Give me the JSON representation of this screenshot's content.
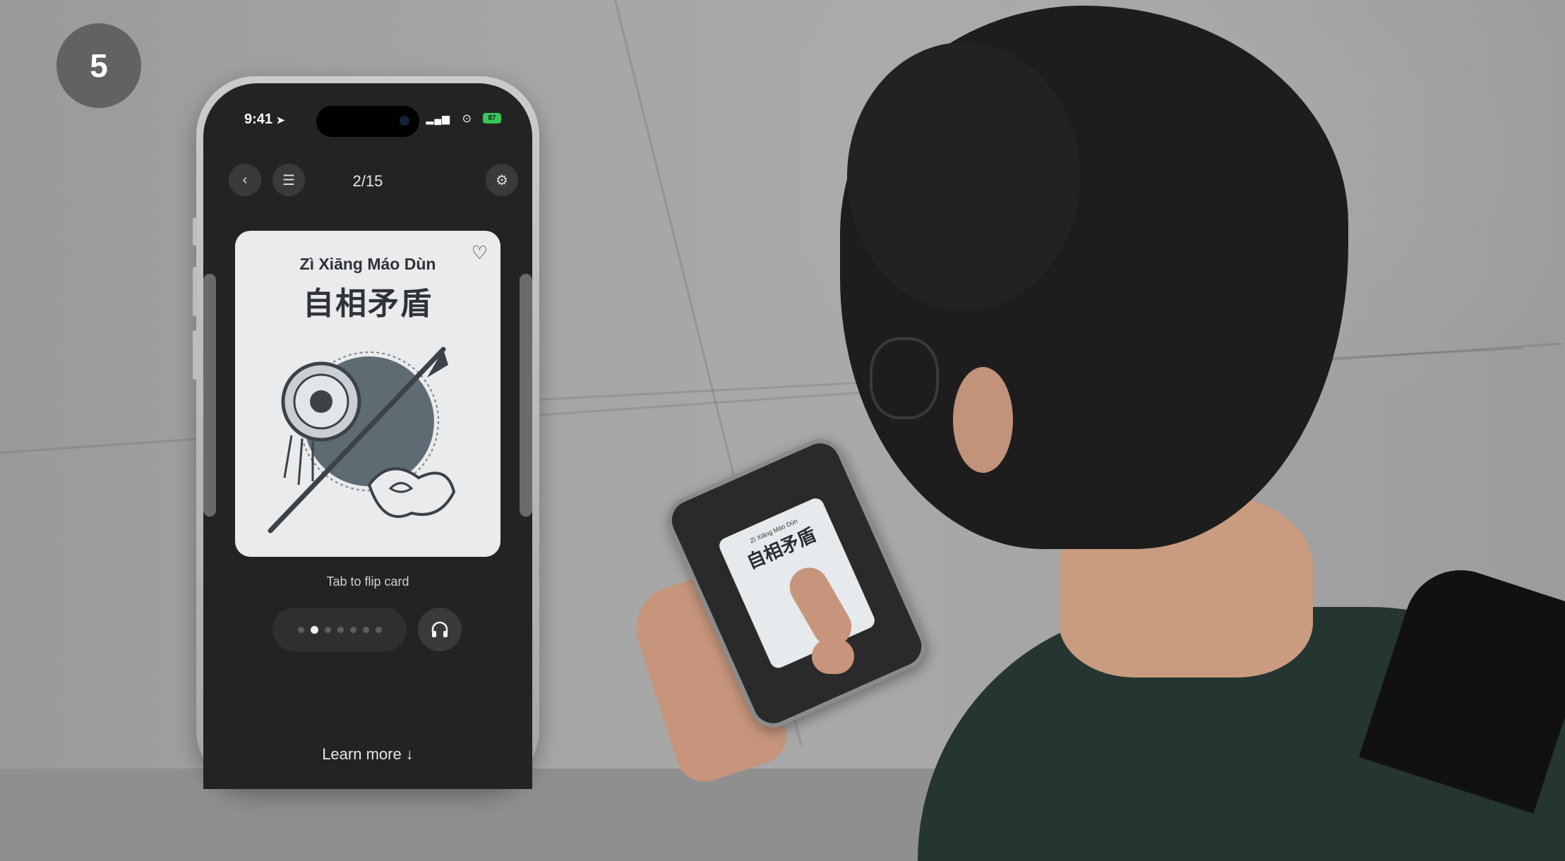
{
  "step": {
    "number": "5"
  },
  "status_bar": {
    "time": "9:41",
    "battery": "87"
  },
  "nav": {
    "counter": "2/15"
  },
  "card": {
    "pinyin": "Zì Xiāng Máo Dùn",
    "characters": "自相矛盾"
  },
  "hint": "Tab to flip card",
  "pager": {
    "total": 7,
    "active_index": 1
  },
  "learn_more": "Learn more ↓",
  "icons": {
    "location": "location-arrow-icon",
    "back": "chevron-left-icon",
    "list": "list-icon",
    "settings": "gear-icon",
    "favorite": "heart-icon",
    "audio": "headphones-icon"
  },
  "colors": {
    "screen_bg": "#232323",
    "card_bg": "#e9ebec",
    "battery": "#35c759",
    "badge": "#626262"
  }
}
